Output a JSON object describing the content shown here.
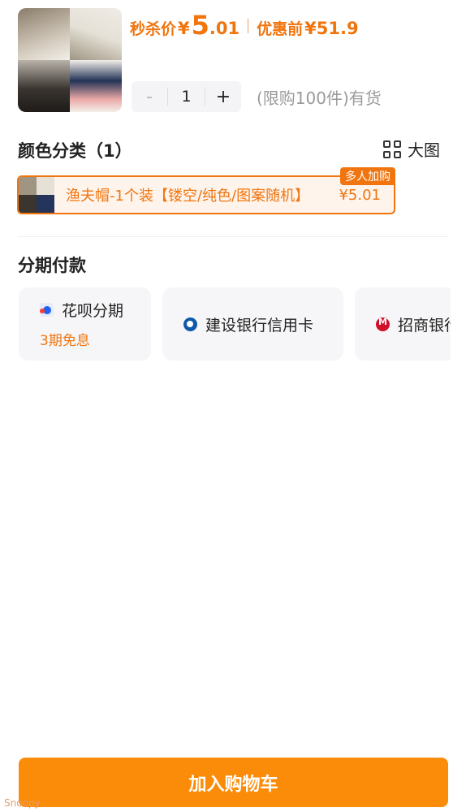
{
  "product": {
    "image_alt": "fishermen hats collage",
    "sale_label": "秒杀价",
    "currency": "¥",
    "sale_price_int": "5",
    "sale_price_dec": ".01",
    "original_label": "优惠前",
    "original_price": "¥51.9"
  },
  "quantity": {
    "minus": "-",
    "value": "1",
    "plus": "+",
    "stock_text": "(限购100件)有货"
  },
  "color_section": {
    "title": "颜色分类（1）",
    "big_view_label": "大图",
    "variant": {
      "name": "渔夫帽-1个装【镂空/纯色/图案随机】",
      "price": "¥5.01",
      "tag": "多人加购"
    }
  },
  "installment": {
    "title": "分期付款",
    "options": [
      {
        "label": "花呗分期",
        "sub": "3期免息",
        "icon": "huabei-icon"
      },
      {
        "label": "建设银行信用卡",
        "sub": "",
        "icon": "ccb-icon"
      },
      {
        "label": "招商银行",
        "sub": "",
        "icon": "cmb-icon"
      }
    ]
  },
  "cta": {
    "add_to_cart": "加入购物车"
  },
  "watermark": "Snoopy",
  "colors": {
    "accent": "#f0750f",
    "button": "#fb8c0a"
  }
}
